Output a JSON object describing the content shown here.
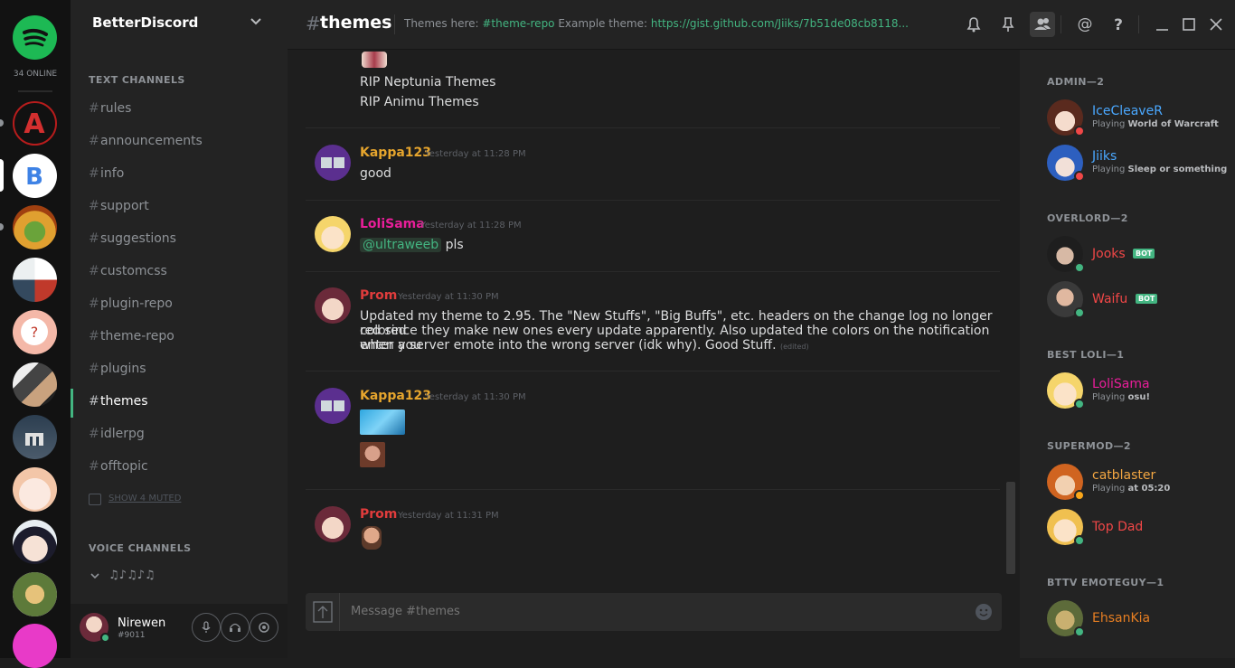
{
  "colors": {
    "accent_green": "#43b581",
    "admin": "#4aa8ff",
    "overlord": "#f04747",
    "best_loli": "#e91e9a",
    "supermod": "#f4a742",
    "bttv": "#e67e22",
    "kappa": "#e6a52d",
    "prom": "#e03c3c"
  },
  "guilds": {
    "online_count": "34 ONLINE",
    "items": [
      {
        "name": "spotify-icon",
        "color": "#1db954"
      },
      {
        "name": "guild-a",
        "color": "#b71c1c"
      },
      {
        "name": "guild-betterdiscord",
        "color": "#ffffff"
      },
      {
        "name": "guild-cactus",
        "color": "#7b4a1a"
      },
      {
        "name": "guild-crossed",
        "color": "#3a3f5c"
      },
      {
        "name": "guild-question",
        "color": "#f4b8a8"
      },
      {
        "name": "guild-collage",
        "color": "#ddd"
      },
      {
        "name": "guild-dark",
        "color": "#37474f"
      },
      {
        "name": "guild-anime",
        "color": "#f6e2d6"
      },
      {
        "name": "guild-boy",
        "color": "#e8eef2"
      },
      {
        "name": "guild-emblem",
        "color": "#5d7a3a"
      },
      {
        "name": "guild-pink",
        "color": "#e83ac8"
      }
    ]
  },
  "sidebar": {
    "server_name": "BetterDiscord",
    "text_category": "TEXT CHANNELS",
    "channels": [
      "rules",
      "announcements",
      "info",
      "support",
      "suggestions",
      "customcss",
      "plugin-repo",
      "theme-repo",
      "plugins",
      "themes",
      "idlerpg",
      "offtopic"
    ],
    "active_channel": "themes",
    "show_muted": "SHOW 4 MUTED",
    "voice_category": "VOICE CHANNELS",
    "voice_channel": "♫♪♫♪♫"
  },
  "user": {
    "name": "Nirewen",
    "tag": "#9011"
  },
  "header": {
    "hash": "#",
    "channel": "themes",
    "topic_prefix": "Themes here: ",
    "topic_channel": "#theme-repo",
    "topic_middle": " Example theme: ",
    "topic_link": "https://gist.github.com/Jiiks/7b51de08cb8118..."
  },
  "messages": {
    "rip1": "RIP Neptunia Themes",
    "rip2": "RIP Animu Themes",
    "m1": {
      "author": "Kappa123",
      "time": "Yesterday at 11:28 PM",
      "text": "good"
    },
    "m2": {
      "author": "LoliSama",
      "time": "Yesterday at 11:28 PM",
      "mention": "@ultraweeb",
      "text": " pls"
    },
    "m3": {
      "author": "Prom",
      "time": "Yesterday at 11:30 PM",
      "line1": "Updated my theme to 2.95. The \"New Stuffs\", \"Big Buffs\", etc. headers on the change log no longer colored",
      "line2": "red since they make new ones every update apparently. Also updated the colors on the notification when you",
      "line3": "enter a server emote into the wrong server (idk why). Good Stuff.",
      "edited": "(edited)"
    },
    "m4": {
      "author": "Kappa123",
      "time": "Yesterday at 11:30 PM"
    },
    "m5": {
      "author": "Prom",
      "time": "Yesterday at 11:31 PM"
    }
  },
  "composer": {
    "placeholder": "Message #themes"
  },
  "members": {
    "roles": [
      {
        "label": "ADMIN—2"
      },
      {
        "label": "OVERLORD—2"
      },
      {
        "label": "BEST LOLI—1"
      },
      {
        "label": "SUPERMOD—2"
      },
      {
        "label": "BTTV EMOTEGUY—1"
      }
    ],
    "list": {
      "icecleaver": {
        "name": "IceCleaveR",
        "game_prefix": "Playing ",
        "game": "World of Warcraft"
      },
      "jiiks": {
        "name": "Jiiks",
        "game_prefix": "Playing ",
        "game": "Sleep or something"
      },
      "jooks": {
        "name": "Jooks",
        "badge": "BOT"
      },
      "waifu": {
        "name": "Waifu",
        "badge": "BOT"
      },
      "lolisama": {
        "name": "LoliSama",
        "game_prefix": "Playing ",
        "game": "osu!"
      },
      "catblaster": {
        "name": "catblaster",
        "game_prefix": "Playing ",
        "game": "at 05:20"
      },
      "topdad": {
        "name": "Top Dad"
      },
      "ehsankia": {
        "name": "EhsanKia"
      }
    }
  }
}
